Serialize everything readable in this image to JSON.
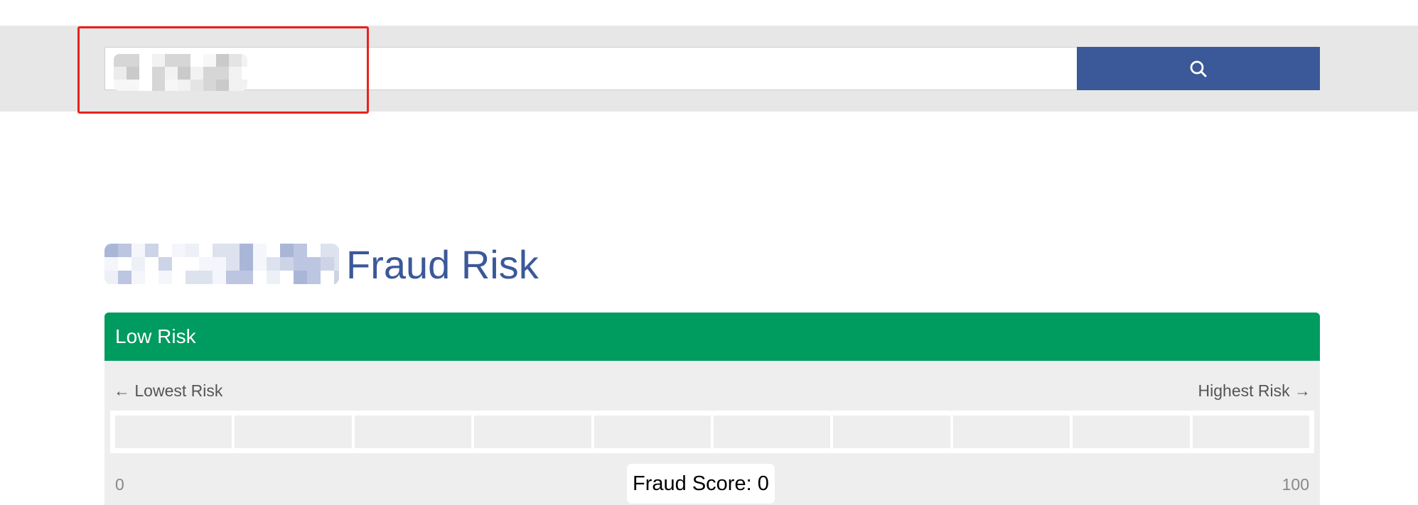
{
  "search": {
    "value": "",
    "button_icon": "search-icon"
  },
  "colors": {
    "brand": "#3b5998",
    "band": "#e7e7e7",
    "risk_low": "#009b5f",
    "panel": "#eeeeee",
    "highlight": "#e8221d"
  },
  "title": {
    "suffix": "Fraud Risk"
  },
  "risk": {
    "level": "Low Risk",
    "scale_left": "← Lowest Risk",
    "scale_right": "Highest Risk →",
    "min_label": "0",
    "max_label": "100",
    "score_label": "Fraud Score:",
    "score_value": "0",
    "score": 0,
    "segments": 10
  }
}
